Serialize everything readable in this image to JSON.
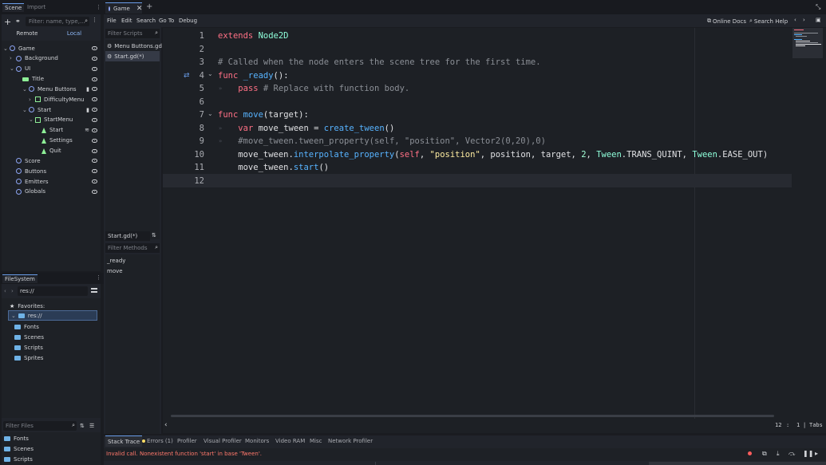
{
  "scene_dock": {
    "tabs": [
      "Scene",
      "Import"
    ],
    "filter_placeholder": "Filter: name, type,...",
    "remote": "Remote",
    "local": "Local",
    "tree": [
      {
        "label": "Game",
        "icon": "node2d-icon"
      },
      {
        "label": "Background",
        "icon": "node2d-icon"
      },
      {
        "label": "UI",
        "icon": "node2d-icon"
      },
      {
        "label": "Title",
        "icon": "label-icon"
      },
      {
        "label": "Menu Buttons",
        "icon": "node2d-icon"
      },
      {
        "label": "DifficultyMenu",
        "icon": "container-icon"
      },
      {
        "label": "Start",
        "icon": "node2d-icon"
      },
      {
        "label": "StartMenu",
        "icon": "container-icon"
      },
      {
        "label": "Start",
        "icon": "button-icon"
      },
      {
        "label": "Settings",
        "icon": "button-icon"
      },
      {
        "label": "Quit",
        "icon": "button-icon"
      },
      {
        "label": "Score",
        "icon": "node2d-icon"
      },
      {
        "label": "Buttons",
        "icon": "node2d-icon"
      },
      {
        "label": "Emitters",
        "icon": "node2d-icon"
      },
      {
        "label": "Globals",
        "icon": "node2d-icon"
      }
    ]
  },
  "filesystem": {
    "title": "FileSystem",
    "path": "res://",
    "favorites": "Favorites:",
    "root": "res://",
    "folders": [
      "Fonts",
      "Scenes",
      "Scripts",
      "Sprites"
    ],
    "filter_placeholder": "Filter Files",
    "bottom_folders": [
      "Fonts",
      "Scenes",
      "Scripts"
    ]
  },
  "editor_tabs": {
    "active": "Game",
    "add": "+"
  },
  "menu": {
    "items": [
      "File",
      "Edit",
      "Search",
      "Go To",
      "Debug"
    ],
    "online_docs": "Online Docs",
    "search_help": "Search Help"
  },
  "scripts": {
    "filter_placeholder": "Filter Scripts",
    "files": [
      "Menu Buttons.gd",
      "Start.gd(*)"
    ],
    "current": "Start.gd(*)",
    "methods_placeholder": "Filter Methods",
    "methods": [
      "_ready",
      "move"
    ]
  },
  "code": {
    "lines": [
      {
        "n": "1",
        "segs": [
          [
            "kw",
            "extends "
          ],
          [
            "cls",
            "Node2D"
          ]
        ]
      },
      {
        "n": "2",
        "segs": []
      },
      {
        "n": "3",
        "segs": [
          [
            "cmt",
            "# Called when the node enters the scene tree for the first time."
          ]
        ]
      },
      {
        "n": "4",
        "segs": [
          [
            "kw",
            "func "
          ],
          [
            "fn",
            "_ready"
          ],
          [
            "",
            "():"
          ]
        ]
      },
      {
        "n": "5",
        "segs": [
          [
            "",
            "    "
          ],
          [
            "kw",
            "pass "
          ],
          [
            "cmt",
            "# Replace with function body."
          ]
        ]
      },
      {
        "n": "6",
        "segs": []
      },
      {
        "n": "7",
        "segs": [
          [
            "kw",
            "func "
          ],
          [
            "fn",
            "move"
          ],
          [
            "",
            "(target):"
          ]
        ]
      },
      {
        "n": "8",
        "segs": [
          [
            "",
            "    "
          ],
          [
            "kw",
            "var "
          ],
          [
            "",
            "move_tween = "
          ],
          [
            "fn",
            "create_tween"
          ],
          [
            "",
            "()"
          ]
        ]
      },
      {
        "n": "9",
        "segs": [
          [
            "",
            "    "
          ],
          [
            "cmt",
            "#move_tween.tween_property(self, \"position\", Vector2(0,20),0)"
          ]
        ]
      },
      {
        "n": "10",
        "segs": [
          [
            "",
            "    move_tween."
          ],
          [
            "fn",
            "interpolate_property"
          ],
          [
            "",
            "("
          ],
          [
            "kw",
            "self"
          ],
          [
            "",
            ", "
          ],
          [
            "str",
            "\"position\""
          ],
          [
            "",
            ", position, target, "
          ],
          [
            "num",
            "2"
          ],
          [
            "",
            ", "
          ],
          [
            "cls",
            "Tween"
          ],
          [
            "",
            ".TRANS_QUINT, "
          ],
          [
            "cls",
            "Tween"
          ],
          [
            "",
            ".EASE_OUT)"
          ]
        ]
      },
      {
        "n": "11",
        "segs": [
          [
            "",
            "    move_tween."
          ],
          [
            "fn",
            "start"
          ],
          [
            "",
            "()"
          ]
        ]
      },
      {
        "n": "12",
        "segs": []
      }
    ],
    "status_line": "12",
    "status_col": "1",
    "status_indent": "Tabs"
  },
  "bottom_panel": {
    "tabs": [
      "Stack Trace",
      "Errors (1)",
      "Profiler",
      "Visual Profiler",
      "Monitors",
      "Video RAM",
      "Misc",
      "Network Profiler"
    ],
    "error_message": "Invalid call. Nonexistent function 'start' in base 'Tween'."
  },
  "colors": {
    "accent": "#699ce8",
    "error": "#ff786b",
    "bg": "#1a1c21"
  }
}
